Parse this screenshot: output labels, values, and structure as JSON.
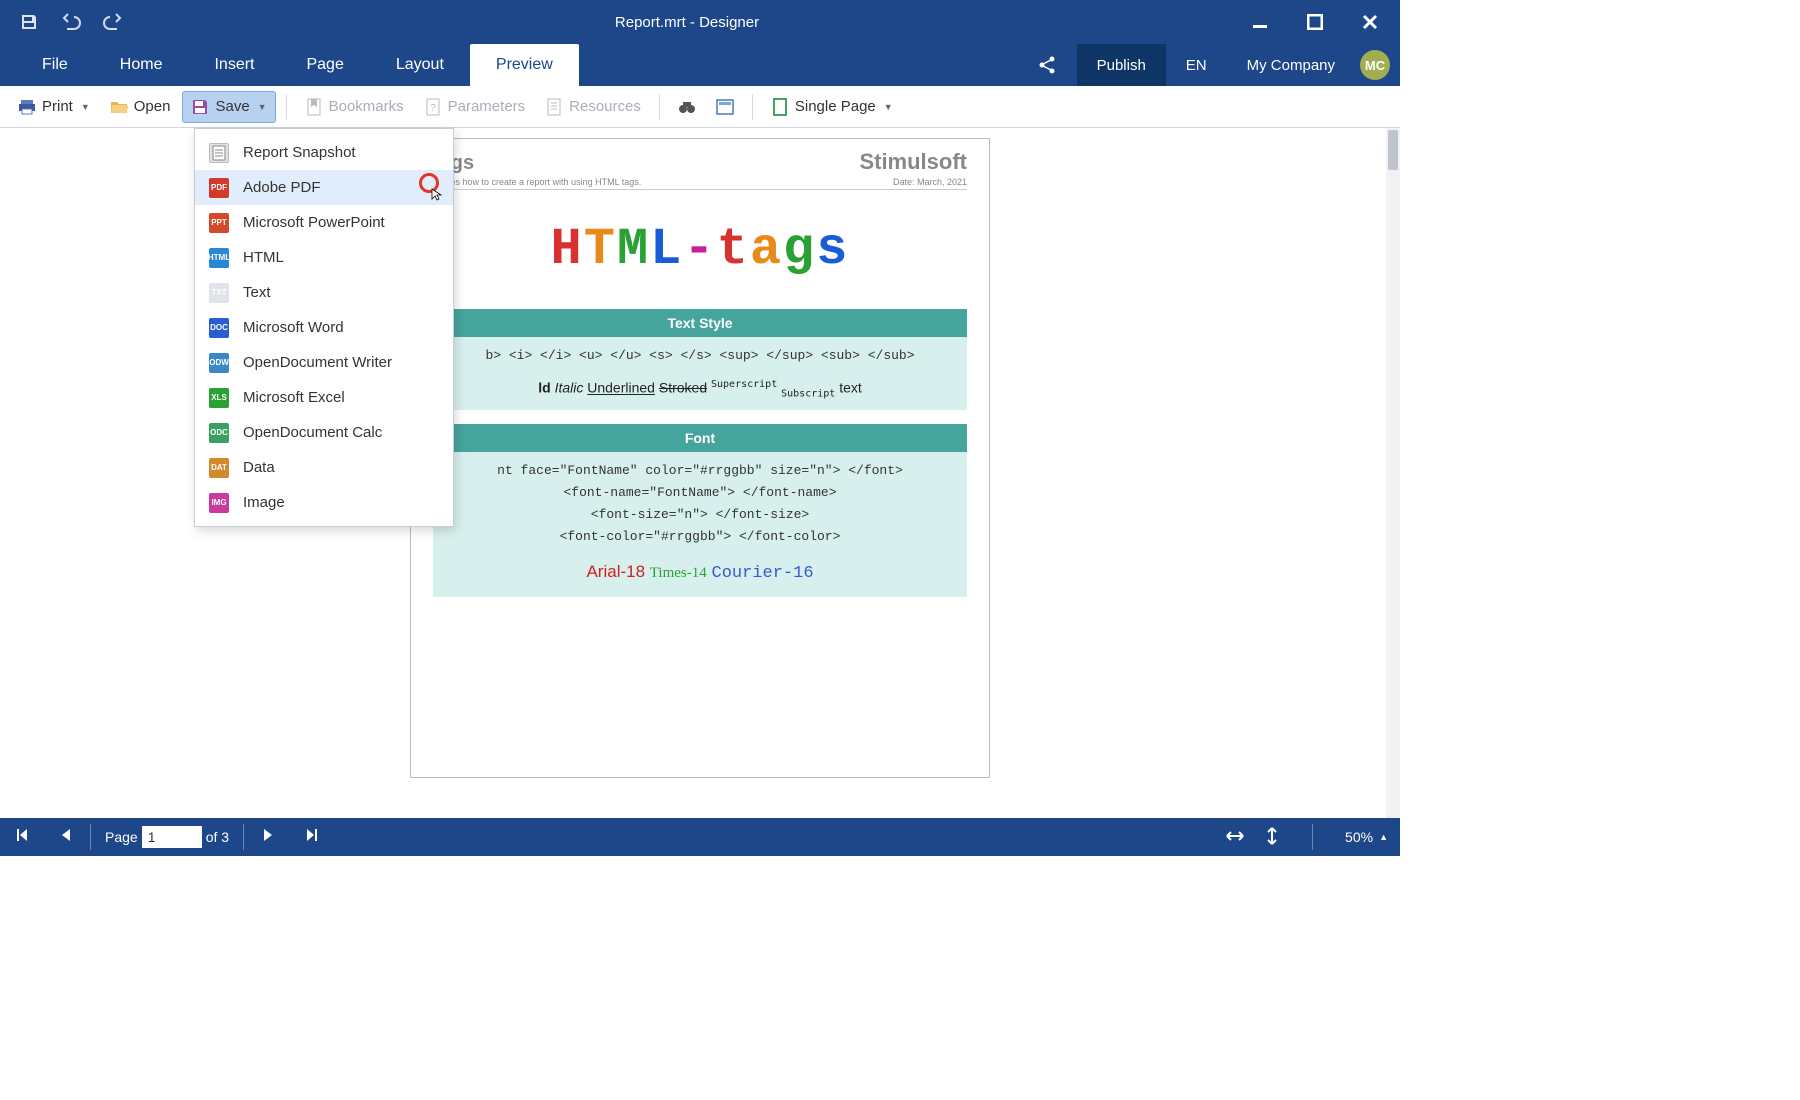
{
  "window": {
    "title": "Report.mrt - Designer"
  },
  "ribbon": {
    "tabs": [
      "File",
      "Home",
      "Insert",
      "Page",
      "Layout",
      "Preview"
    ],
    "active": "Preview",
    "publish": "Publish",
    "language": "EN",
    "company": "My Company",
    "avatar": "MC"
  },
  "toolbar": {
    "print": "Print",
    "open": "Open",
    "save": "Save",
    "bookmarks": "Bookmarks",
    "parameters": "Parameters",
    "resources": "Resources",
    "single_page": "Single Page"
  },
  "save_menu": {
    "items": [
      {
        "label": "Report Snapshot",
        "icon_bg": "#e0e4ea",
        "icon_txt": "",
        "kind": "snapshot"
      },
      {
        "label": "Adobe PDF",
        "icon_bg": "#d23a2a",
        "icon_txt": "PDF",
        "hover": true,
        "kind": "pdf"
      },
      {
        "label": "Microsoft PowerPoint",
        "icon_bg": "#d24a2a",
        "icon_txt": "PPT",
        "kind": "ppt"
      },
      {
        "label": "HTML",
        "icon_bg": "#2a88d2",
        "icon_txt": "HTML",
        "kind": "html"
      },
      {
        "label": "Text",
        "icon_bg": "#e0e4ea",
        "icon_txt": "TXT",
        "kind": "txt"
      },
      {
        "label": "Microsoft Word",
        "icon_bg": "#2a5cd2",
        "icon_txt": "DOC",
        "kind": "doc"
      },
      {
        "label": "OpenDocument Writer",
        "icon_bg": "#3a88c8",
        "icon_txt": "ODW",
        "kind": "odw"
      },
      {
        "label": "Microsoft Excel",
        "icon_bg": "#2aa035",
        "icon_txt": "XLS",
        "kind": "xls"
      },
      {
        "label": "OpenDocument Calc",
        "icon_bg": "#3aa060",
        "icon_txt": "ODC",
        "kind": "odc"
      },
      {
        "label": "Data",
        "icon_bg": "#d28a2a",
        "icon_txt": "DAT",
        "kind": "dat"
      },
      {
        "label": "Image",
        "icon_bg": "#c83a9e",
        "icon_txt": "IMG",
        "kind": "img"
      }
    ]
  },
  "report": {
    "head_left": "tags",
    "head_right": "Stimulsoft",
    "sub_left": "strates how to create a report with using HTML tags.",
    "sub_right": "Date: March, 2021",
    "big_letters": [
      "H",
      "T",
      "M",
      "L",
      "-",
      "t",
      "a",
      "g",
      "s"
    ],
    "sec1_title": "Text Style",
    "sec1_codes": "b> <i> </i> <u> </u> <s> </s> <sup> </sup> <sub> </sub>",
    "sec1_demo": {
      "bold": "ld",
      "italic": "Italic",
      "under": "Underlined",
      "strike": "Stroked",
      "sup": "Superscript",
      "sub": "Subscript",
      "tail": "text"
    },
    "sec2_title": "Font",
    "sec2_codes": "nt face=\"FontName\" color=\"#rrggbb\" size=\"n\"> </font>\n<font-name=\"FontName\"> </font-name>\n<font-size=\"n\"> </font-size>\n<font-color=\"#rrggbb\"> </font-color>",
    "sec2_demo": {
      "a": "Arial-18",
      "b": "Times-14",
      "c": "Courier-16"
    }
  },
  "status": {
    "page_label": "Page",
    "current_page": "1",
    "page_of": "of 3",
    "zoom": "50%"
  }
}
